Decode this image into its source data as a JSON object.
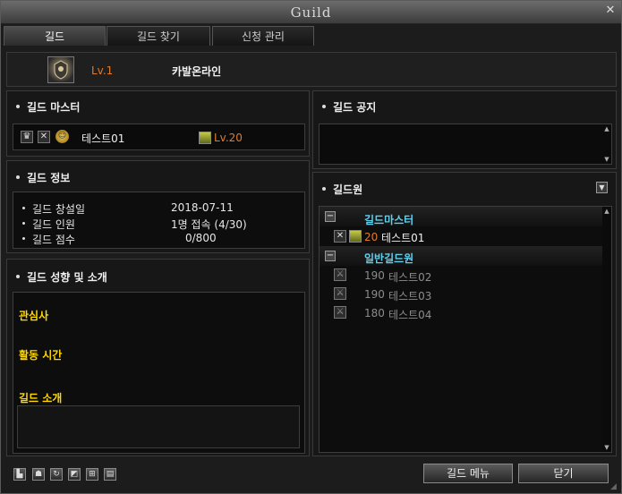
{
  "window": {
    "title": "Guild"
  },
  "tabs": [
    {
      "label": "길드"
    },
    {
      "label": "길드 찾기"
    },
    {
      "label": "신청 관리"
    }
  ],
  "header": {
    "level": "Lv.1",
    "guild_name": "카발온라인"
  },
  "guild_master": {
    "title": "길드 마스터",
    "name": "테스트01",
    "level": "Lv.20"
  },
  "guild_info": {
    "title": "길드 정보",
    "rows": [
      {
        "label": "길드 창설일",
        "value": "2018-07-11"
      },
      {
        "label": "길드 인원",
        "value": "1명 접속 (4/30)"
      },
      {
        "label": "길드 점수",
        "value": "0/800"
      }
    ]
  },
  "guild_intro": {
    "title": "길드 성향 및 소개",
    "interest_label": "관심사",
    "activity_label": "활동 시간",
    "intro_label": "길드 소개"
  },
  "guild_notice": {
    "title": "길드 공지"
  },
  "members": {
    "title": "길드원",
    "master_group": "길드마스터",
    "normal_group": "일반길드원",
    "master_row": {
      "level": "20",
      "name": "테스트01"
    },
    "normal_rows": [
      {
        "level": "190",
        "name": "테스트02"
      },
      {
        "level": "190",
        "name": "테스트03"
      },
      {
        "level": "180",
        "name": "테스트04"
      }
    ]
  },
  "buttons": {
    "guild_menu": "길드 메뉴",
    "close": "닫기"
  },
  "colors": {
    "accent_orange": "#e07a2c",
    "label_yellow": "#ffd800",
    "group_cyan": "#5fd0ee"
  }
}
